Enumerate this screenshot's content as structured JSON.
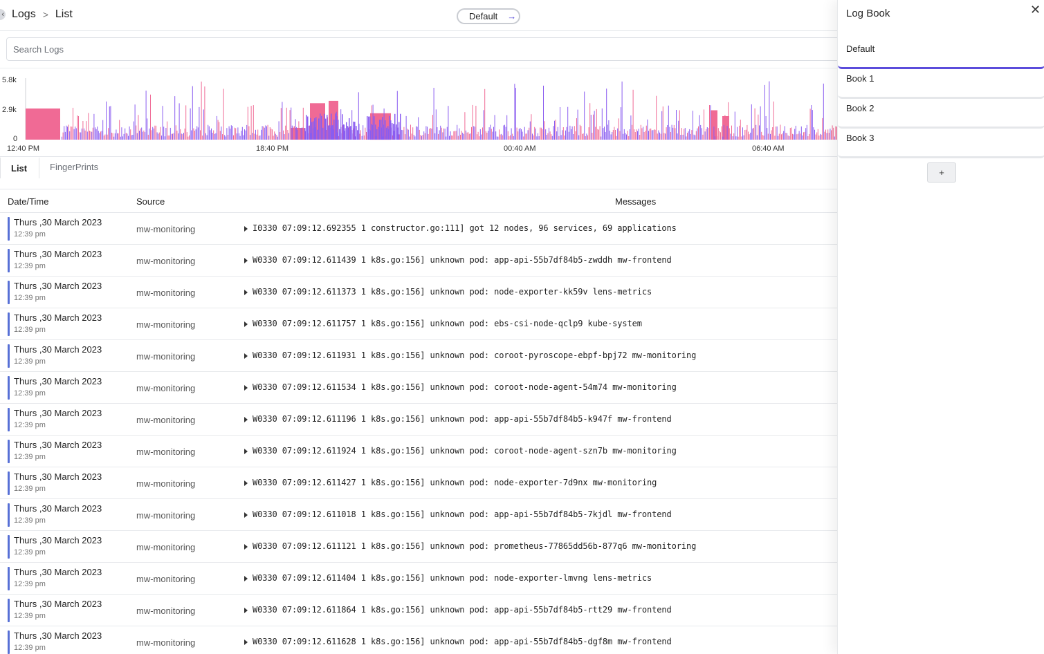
{
  "breadcrumb": {
    "root": "Logs",
    "separator": ">",
    "current": "List"
  },
  "logbook_selector": {
    "label": "Default",
    "arrow_icon": "arrow-right-icon"
  },
  "search": {
    "placeholder": "Search Logs",
    "value": ""
  },
  "chart_data": {
    "type": "bar",
    "title": "",
    "xlabel": "",
    "ylabel": "",
    "y_ticks": [
      "5.8k",
      "2.9k",
      "0"
    ],
    "ylim": [
      0,
      5800
    ],
    "x_ticks": [
      "12:40 PM",
      "18:40 PM",
      "00:40 AM",
      "06:40 AM"
    ],
    "series": [
      {
        "color": "#f06a95"
      },
      {
        "color": "#8a5cf0"
      }
    ],
    "note_values": "dense histogram of log counts over ~21 hours; most bars below 2.9k, peaks up to ~5.8k"
  },
  "tabs": [
    {
      "label": "List",
      "active": true
    },
    {
      "label": "FingerPrints",
      "active": false
    }
  ],
  "table": {
    "columns": [
      "Date/Time",
      "Source",
      "Messages"
    ],
    "rows": [
      {
        "date": "Thurs ,30 March 2023",
        "time": "12:39 pm",
        "source": "mw-monitoring",
        "message": "I0330 07:09:12.692355 1 constructor.go:111] got 12 nodes, 96 services, 69 applications"
      },
      {
        "date": "Thurs ,30 March 2023",
        "time": "12:39 pm",
        "source": "mw-monitoring",
        "message": "W0330 07:09:12.611439 1 k8s.go:156] unknown pod: app-api-55b7df84b5-zwddh mw-frontend"
      },
      {
        "date": "Thurs ,30 March 2023",
        "time": "12:39 pm",
        "source": "mw-monitoring",
        "message": "W0330 07:09:12.611373 1 k8s.go:156] unknown pod: node-exporter-kk59v lens-metrics"
      },
      {
        "date": "Thurs ,30 March 2023",
        "time": "12:39 pm",
        "source": "mw-monitoring",
        "message": "W0330 07:09:12.611757 1 k8s.go:156] unknown pod: ebs-csi-node-qclp9 kube-system"
      },
      {
        "date": "Thurs ,30 March 2023",
        "time": "12:39 pm",
        "source": "mw-monitoring",
        "message": "W0330 07:09:12.611931 1 k8s.go:156] unknown pod: coroot-pyroscope-ebpf-bpj72 mw-monitoring"
      },
      {
        "date": "Thurs ,30 March 2023",
        "time": "12:39 pm",
        "source": "mw-monitoring",
        "message": "W0330 07:09:12.611534 1 k8s.go:156] unknown pod: coroot-node-agent-54m74 mw-monitoring"
      },
      {
        "date": "Thurs ,30 March 2023",
        "time": "12:39 pm",
        "source": "mw-monitoring",
        "message": "W0330 07:09:12.611196 1 k8s.go:156] unknown pod: app-api-55b7df84b5-k947f mw-frontend"
      },
      {
        "date": "Thurs ,30 March 2023",
        "time": "12:39 pm",
        "source": "mw-monitoring",
        "message": "W0330 07:09:12.611924 1 k8s.go:156] unknown pod: coroot-node-agent-szn7b mw-monitoring"
      },
      {
        "date": "Thurs ,30 March 2023",
        "time": "12:39 pm",
        "source": "mw-monitoring",
        "message": "W0330 07:09:12.611427 1 k8s.go:156] unknown pod: node-exporter-7d9nx mw-monitoring"
      },
      {
        "date": "Thurs ,30 March 2023",
        "time": "12:39 pm",
        "source": "mw-monitoring",
        "message": "W0330 07:09:12.611018 1 k8s.go:156] unknown pod: app-api-55b7df84b5-7kjdl mw-frontend"
      },
      {
        "date": "Thurs ,30 March 2023",
        "time": "12:39 pm",
        "source": "mw-monitoring",
        "message": "W0330 07:09:12.611121 1 k8s.go:156] unknown pod: prometheus-77865dd56b-877q6 mw-monitoring"
      },
      {
        "date": "Thurs ,30 March 2023",
        "time": "12:39 pm",
        "source": "mw-monitoring",
        "message": "W0330 07:09:12.611404 1 k8s.go:156] unknown pod: node-exporter-lmvng lens-metrics"
      },
      {
        "date": "Thurs ,30 March 2023",
        "time": "12:39 pm",
        "source": "mw-monitoring",
        "message": "W0330 07:09:12.611864 1 k8s.go:156] unknown pod: app-api-55b7df84b5-rtt29 mw-frontend"
      },
      {
        "date": "Thurs ,30 March 2023",
        "time": "12:39 pm",
        "source": "mw-monitoring",
        "message": "W0330 07:09:12.611628 1 k8s.go:156] unknown pod: app-api-55b7df84b5-dgf8m mw-frontend"
      }
    ]
  },
  "logbook_panel": {
    "title": "Log Book",
    "close_icon": "close-icon",
    "books": [
      {
        "label": "Default",
        "active": true
      },
      {
        "label": "Book 1",
        "active": false
      },
      {
        "label": "Book 2",
        "active": false
      },
      {
        "label": "Book 3",
        "active": false
      }
    ],
    "add_label": "+"
  },
  "colors": {
    "accent": "#5b4cdb",
    "row_marker": "#5770d6",
    "series_pink": "#f06a95",
    "series_purple": "#8a5cf0"
  }
}
